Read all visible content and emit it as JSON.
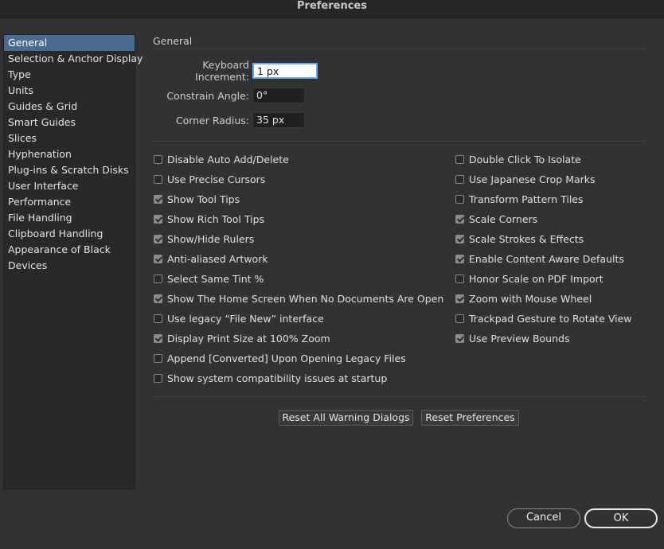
{
  "window": {
    "title": "Preferences"
  },
  "sidebar": {
    "items": [
      {
        "label": "General",
        "selected": true
      },
      {
        "label": "Selection & Anchor Display"
      },
      {
        "label": "Type"
      },
      {
        "label": "Units"
      },
      {
        "label": "Guides & Grid"
      },
      {
        "label": "Smart Guides"
      },
      {
        "label": "Slices"
      },
      {
        "label": "Hyphenation"
      },
      {
        "label": "Plug-ins & Scratch Disks"
      },
      {
        "label": "User Interface"
      },
      {
        "label": "Performance"
      },
      {
        "label": "File Handling"
      },
      {
        "label": "Clipboard Handling"
      },
      {
        "label": "Appearance of Black"
      },
      {
        "label": "Devices"
      }
    ]
  },
  "general": {
    "title": "General",
    "fields": [
      {
        "label": "Keyboard Increment:",
        "value": "1 px"
      },
      {
        "label": "Constrain Angle:",
        "value": "0°"
      },
      {
        "label": "Corner Radius:",
        "value": "35 px"
      }
    ],
    "left_options": [
      {
        "label": "Disable Auto Add/Delete",
        "checked": false
      },
      {
        "label": "Use Precise Cursors",
        "checked": false
      },
      {
        "label": "Show Tool Tips",
        "checked": true
      },
      {
        "label": "Show Rich Tool Tips",
        "checked": true
      },
      {
        "label": "Show/Hide Rulers",
        "checked": true
      },
      {
        "label": "Anti-aliased Artwork",
        "checked": true
      },
      {
        "label": "Select Same Tint %",
        "checked": false
      },
      {
        "label": "Show The Home Screen When No Documents Are Open",
        "checked": true
      },
      {
        "label": "Use legacy “File New” interface",
        "checked": false
      },
      {
        "label": "Display Print Size at 100% Zoom",
        "checked": true
      },
      {
        "label": "Append [Converted] Upon Opening Legacy Files",
        "checked": false
      },
      {
        "label": "Show system compatibility issues at startup",
        "checked": false
      }
    ],
    "right_options": [
      {
        "label": "Double Click To Isolate",
        "checked": false
      },
      {
        "label": "Use Japanese Crop Marks",
        "checked": false
      },
      {
        "label": "Transform Pattern Tiles",
        "checked": false
      },
      {
        "label": "Scale Corners",
        "checked": true
      },
      {
        "label": "Scale Strokes & Effects",
        "checked": true
      },
      {
        "label": "Enable Content Aware Defaults",
        "checked": true
      },
      {
        "label": "Honor Scale on PDF Import",
        "checked": false
      },
      {
        "label": "Zoom with Mouse Wheel",
        "checked": true
      },
      {
        "label": "Trackpad Gesture to Rotate View",
        "checked": false
      },
      {
        "label": "Use Preview Bounds",
        "checked": true
      }
    ],
    "reset_warnings_label": "Reset All Warning Dialogs",
    "reset_prefs_label": "Reset Preferences"
  },
  "footer": {
    "cancel_label": "Cancel",
    "ok_label": "OK"
  }
}
